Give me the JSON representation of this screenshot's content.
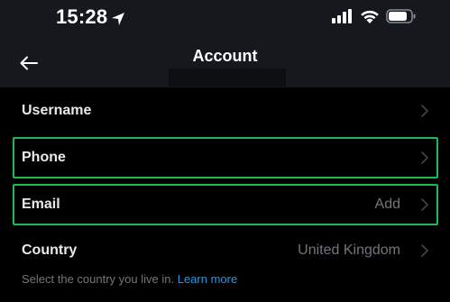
{
  "status_bar": {
    "time": "15:28",
    "icons": [
      "location-arrow-icon",
      "signal-icon",
      "wifi-icon",
      "battery-icon"
    ]
  },
  "nav": {
    "back_icon": "arrow-left-icon",
    "title": "Account"
  },
  "rows": [
    {
      "label": "Username",
      "value": ""
    },
    {
      "label": "Phone",
      "value": ""
    },
    {
      "label": "Email",
      "value": "Add"
    },
    {
      "label": "Country",
      "value": "United Kingdom"
    }
  ],
  "country_helper": {
    "text": "Select the country you live in.",
    "link": "Learn more"
  },
  "colors": {
    "background": "#000000",
    "header_background": "#15181c",
    "text_primary": "#e7e9ea",
    "text_secondary": "#71767b",
    "link": "#1d9bf0",
    "highlight": "#1db954"
  }
}
